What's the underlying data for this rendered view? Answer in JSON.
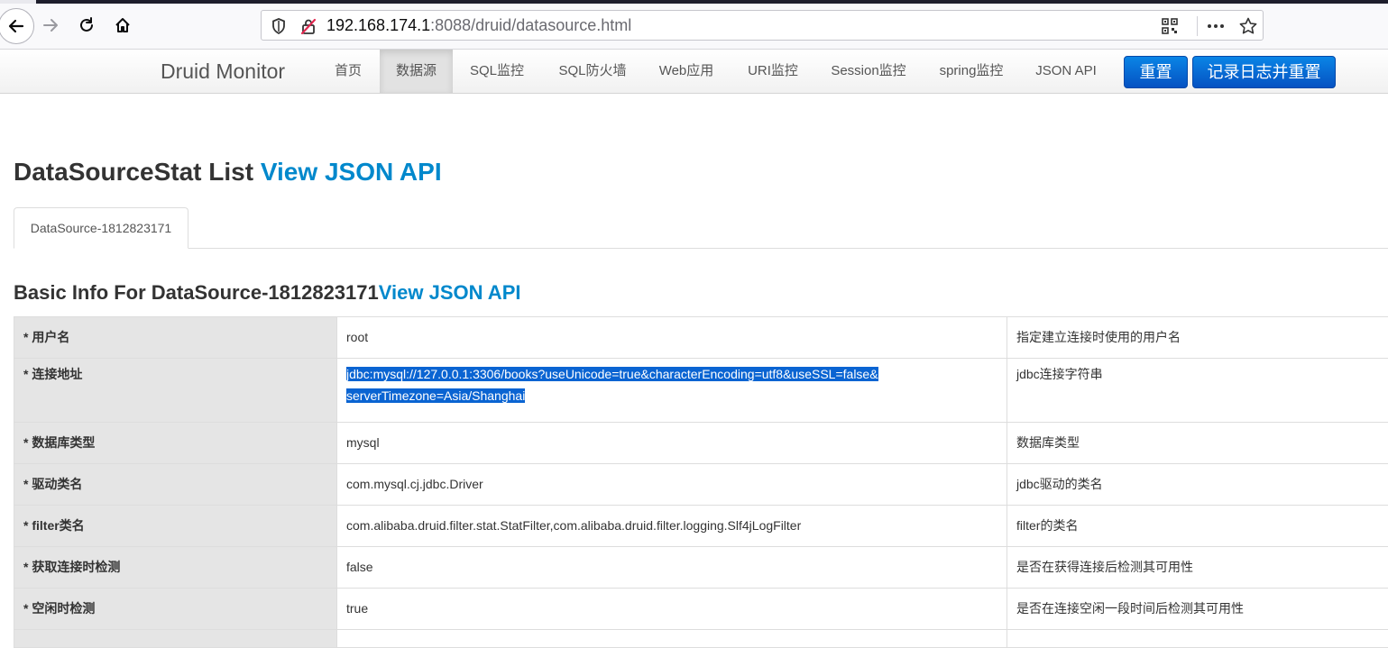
{
  "browser": {
    "url_host": "192.168.174.1",
    "url_rest": ":8088/druid/datasource.html"
  },
  "navbar": {
    "brand": "Druid Monitor",
    "items": [
      {
        "label": "首页"
      },
      {
        "label": "数据源"
      },
      {
        "label": "SQL监控"
      },
      {
        "label": "SQL防火墙"
      },
      {
        "label": "Web应用"
      },
      {
        "label": "URI监控"
      },
      {
        "label": "Session监控"
      },
      {
        "label": "spring监控"
      },
      {
        "label": "JSON API"
      }
    ],
    "reset_label": "重置",
    "log_reset_label": "记录日志并重置"
  },
  "page": {
    "title": "DataSourceStat List ",
    "title_link": "View JSON API",
    "tab_label": "DataSource-1812823171",
    "section_title": "Basic Info For DataSource-1812823171",
    "section_link": "View JSON API"
  },
  "table": {
    "rows": [
      {
        "key": "* 用户名",
        "value": "root",
        "desc": "指定建立连接时使用的用户名"
      },
      {
        "key": "* 连接地址",
        "value_line1": "jdbc:mysql://127.0.0.1:3306/books?useUnicode=true&characterEncoding=utf8&useSSL=false&",
        "value_line2": "serverTimezone=Asia/Shanghai",
        "desc": "jdbc连接字符串"
      },
      {
        "key": "* 数据库类型",
        "value": "mysql",
        "desc": "数据库类型"
      },
      {
        "key": "* 驱动类名",
        "value": "com.mysql.cj.jdbc.Driver",
        "desc": "jdbc驱动的类名"
      },
      {
        "key": "* filter类名",
        "value": "com.alibaba.druid.filter.stat.StatFilter,com.alibaba.druid.filter.logging.Slf4jLogFilter",
        "desc": "filter的类名"
      },
      {
        "key": "* 获取连接时检测",
        "value": "false",
        "desc": "是否在获得连接后检测其可用性"
      },
      {
        "key": "* 空闲时检测",
        "value": "true",
        "desc": "是否在连接空闲一段时间后检测其可用性"
      }
    ]
  },
  "colors": {
    "link": "#0088cc",
    "button": "#0a6fd8",
    "selection": "#0a64d2"
  }
}
